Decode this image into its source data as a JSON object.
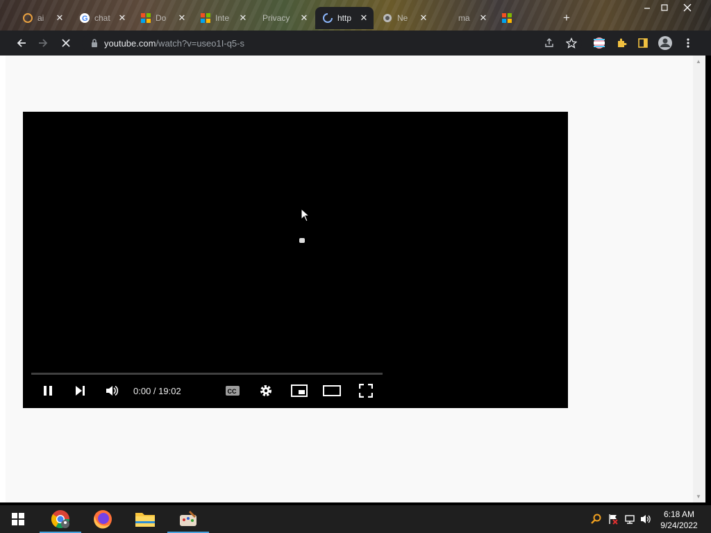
{
  "browser": {
    "tabs": [
      {
        "title": "ai",
        "favicon": "generic-favicon"
      },
      {
        "title": "chat",
        "favicon": "google-favicon"
      },
      {
        "title": "Do",
        "favicon": "microsoft-favicon"
      },
      {
        "title": "Inte",
        "favicon": "microsoft-favicon"
      },
      {
        "title": "Privacy",
        "favicon": "none"
      },
      {
        "title": "http",
        "favicon": "loading-spinner",
        "active": true
      },
      {
        "title": "Ne",
        "favicon": "generic-favicon"
      },
      {
        "title": "ma",
        "favicon": "none"
      },
      {
        "title": "",
        "favicon": "microsoft-favicon"
      }
    ],
    "new_tab": "+",
    "close_glyph": "✕",
    "url_host": "youtube.com",
    "url_path": "/watch?v=useo1I-q5-s"
  },
  "player": {
    "time": "0:00 / 19:02",
    "progress_fraction": 0,
    "controls": [
      "pause",
      "next",
      "volume",
      "captions",
      "settings",
      "miniplayer",
      "theater",
      "fullscreen"
    ]
  },
  "taskbar": {
    "apps": [
      "start",
      "chrome",
      "firefox",
      "file-explorer",
      "paint-app"
    ],
    "clock_time": "6:18 AM",
    "clock_date": "9/24/2022"
  },
  "colors": {
    "tab_active_bg": "#202124",
    "page_bg": "#f9f9f9",
    "player_bg": "#000000",
    "taskbar_bg": "#1f1f1f",
    "accent": "#4aa3df"
  }
}
